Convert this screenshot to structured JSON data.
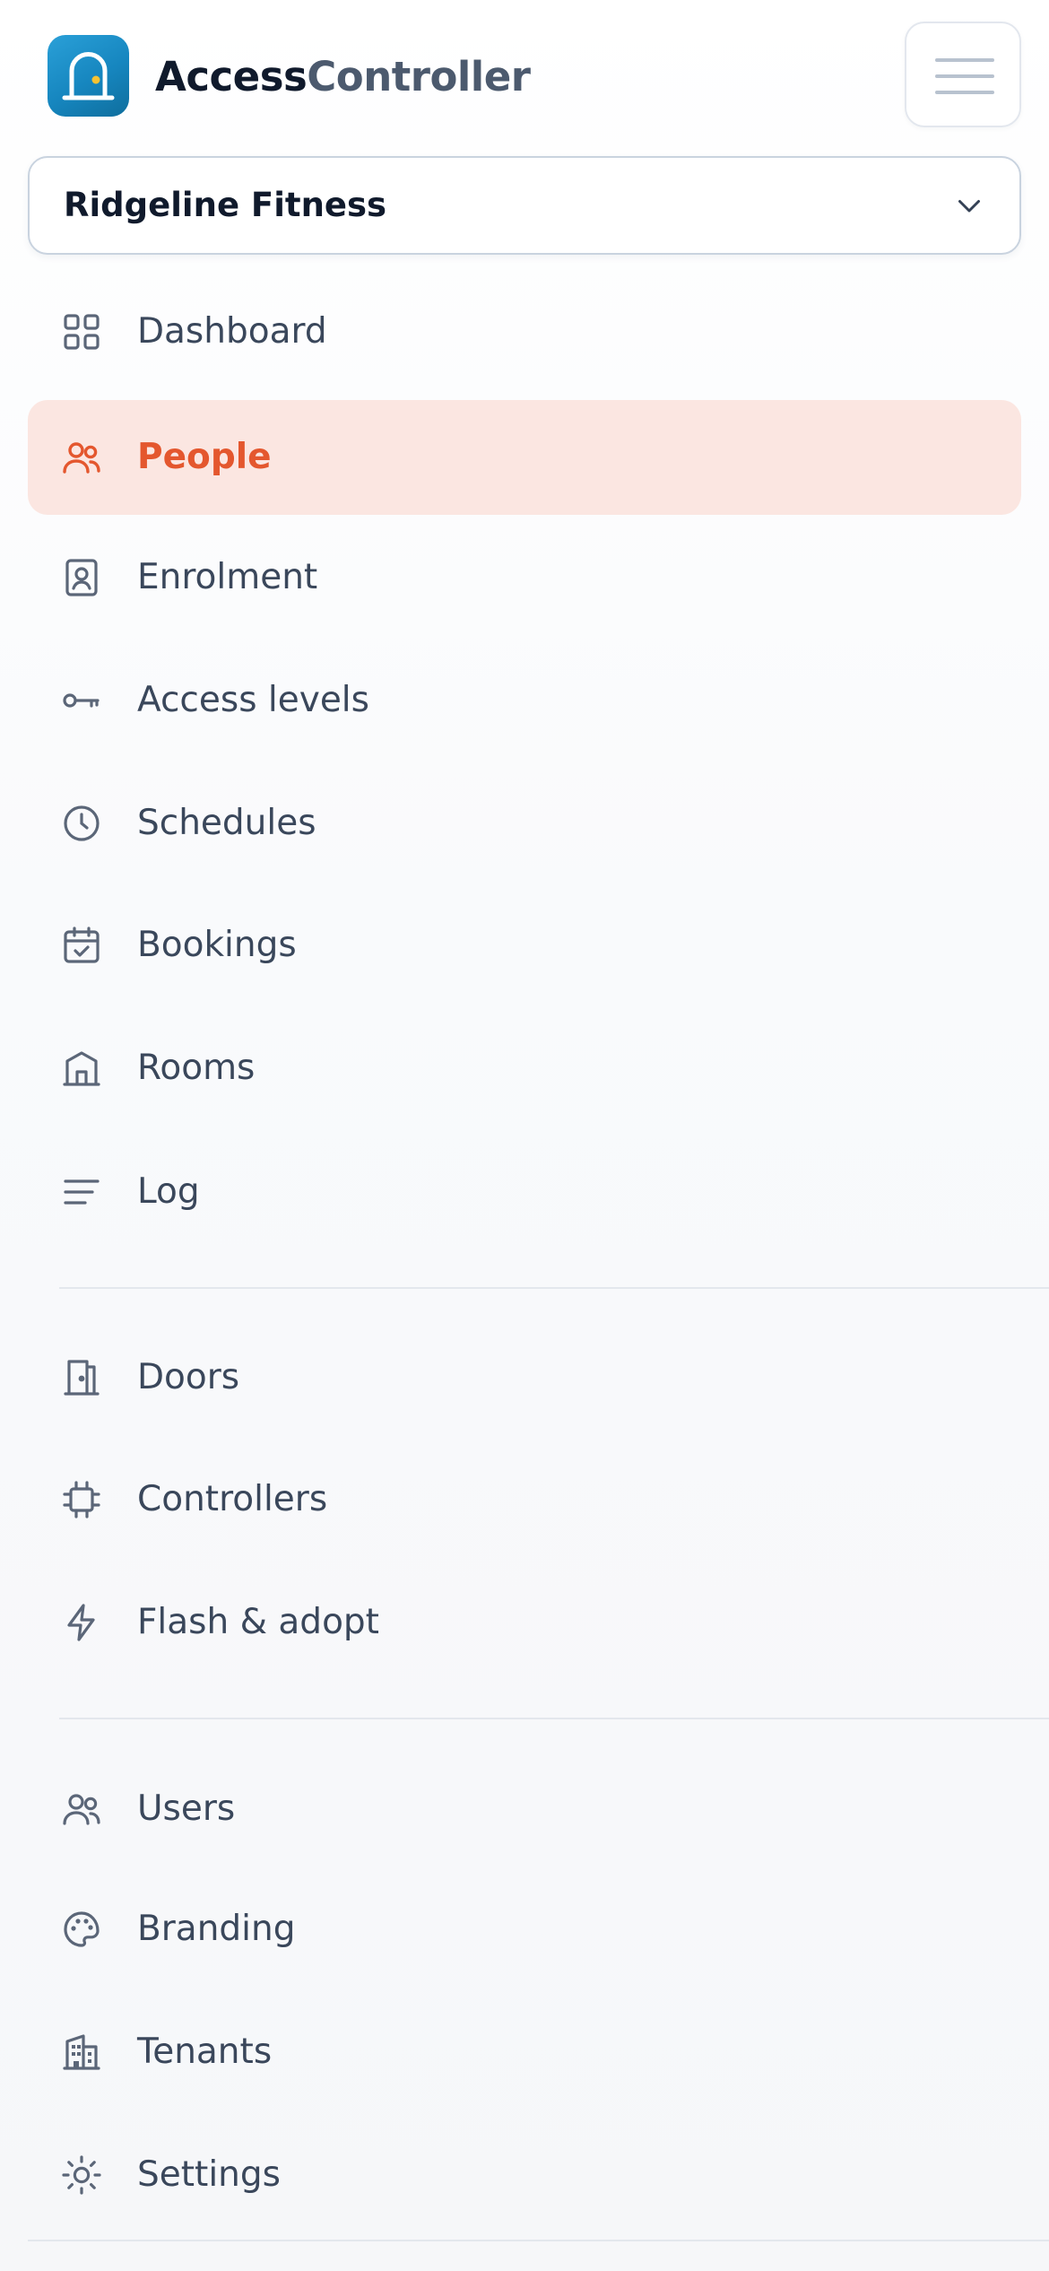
{
  "app": {
    "brand_part1": "Access",
    "brand_part2": "Controller",
    "logo_icon": "door-icon",
    "menu_icon": "hamburger-menu-icon"
  },
  "tenant_select": {
    "value": "Ridgeline Fitness",
    "icon": "chevron-down-icon"
  },
  "nav": {
    "items": [
      {
        "label": "Dashboard",
        "icon": "dashboard-grid-icon",
        "active": false
      },
      {
        "label": "People",
        "icon": "people-icon",
        "active": true
      },
      {
        "label": "Enrolment",
        "icon": "id-badge-icon",
        "active": false
      },
      {
        "label": "Access levels",
        "icon": "key-icon",
        "active": false
      },
      {
        "label": "Schedules",
        "icon": "clock-icon",
        "active": false
      },
      {
        "label": "Bookings",
        "icon": "calendar-check-icon",
        "active": false
      },
      {
        "label": "Rooms",
        "icon": "room-icon",
        "active": false
      },
      {
        "label": "Log",
        "icon": "list-lines-icon",
        "active": false
      },
      {
        "label": "Doors",
        "icon": "door-icon",
        "active": false
      },
      {
        "label": "Controllers",
        "icon": "chip-icon",
        "active": false
      },
      {
        "label": "Flash & adopt",
        "icon": "lightning-icon",
        "active": false
      },
      {
        "label": "Users",
        "icon": "users-icon",
        "active": false
      },
      {
        "label": "Branding",
        "icon": "palette-icon",
        "active": false
      },
      {
        "label": "Tenants",
        "icon": "building-icon",
        "active": false
      },
      {
        "label": "Settings",
        "icon": "sun-settings-icon",
        "active": false
      }
    ]
  },
  "colors": {
    "accent": "#e4572e",
    "active_bg": "#fbe6e1",
    "logo_blue": "#1686bf",
    "text": "#3a475b"
  }
}
